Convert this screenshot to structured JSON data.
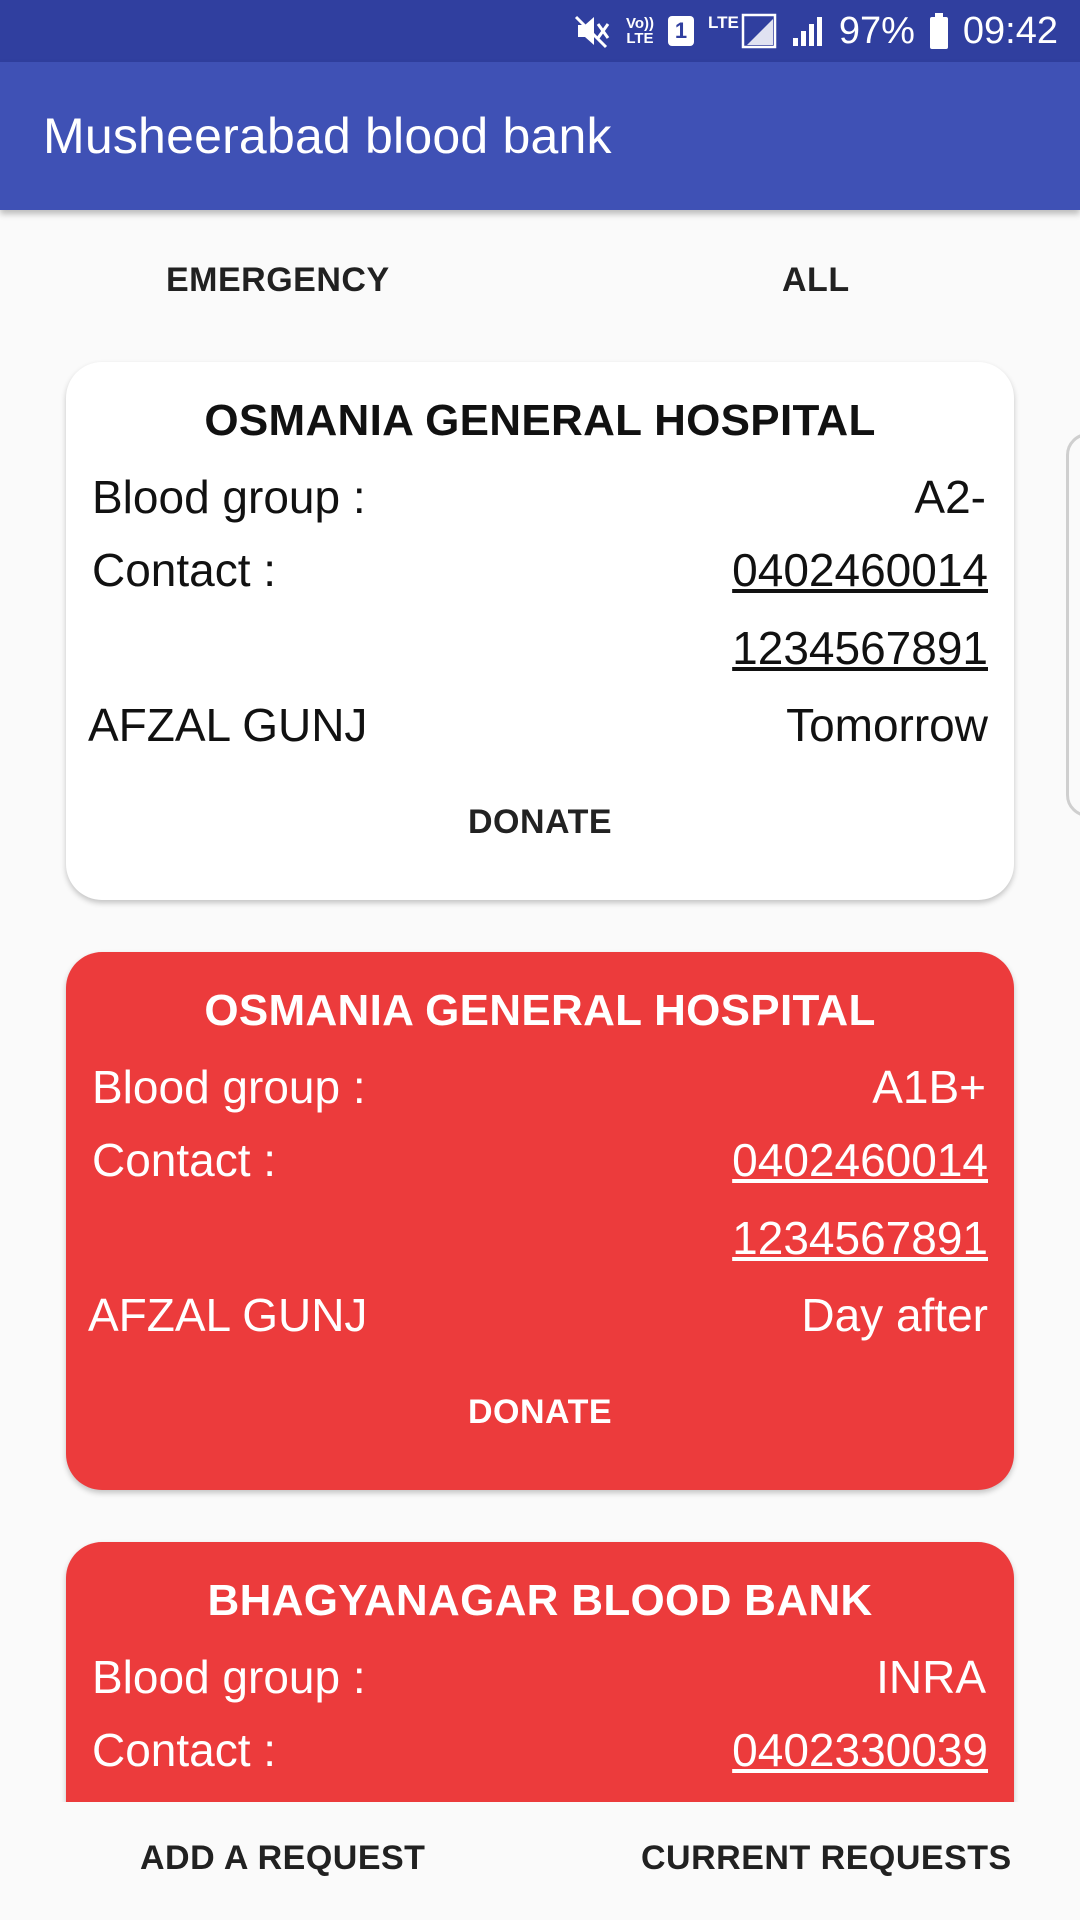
{
  "status_bar": {
    "battery": "97%",
    "time": "09:42",
    "sim_badge": "1",
    "network": "LTE",
    "volte_line1": "Vo))",
    "volte_line2": "LTE"
  },
  "app_bar": {
    "title": "Musheerabad blood bank"
  },
  "tabs": {
    "emergency": "EMERGENCY",
    "all": "ALL"
  },
  "cards": [
    {
      "style": "white",
      "hospital": "OSMANIA GENERAL HOSPITAL",
      "blood_group_label": "Blood group :",
      "blood_group": "A2-",
      "contact_label": "Contact :",
      "phone1": "0402460014",
      "phone2": "1234567891",
      "location": "AFZAL GUNJ",
      "when": "Tomorrow",
      "donate_label": "DONATE"
    },
    {
      "style": "red",
      "hospital": "OSMANIA GENERAL HOSPITAL",
      "blood_group_label": "Blood group :",
      "blood_group": "A1B+",
      "contact_label": "Contact :",
      "phone1": "0402460014",
      "phone2": "1234567891",
      "location": "AFZAL GUNJ",
      "when": "Day after",
      "donate_label": "DONATE"
    },
    {
      "style": "red",
      "hospital": "BHAGYANAGAR BLOOD BANK",
      "blood_group_label": "Blood group :",
      "blood_group": "INRA",
      "contact_label": "Contact :",
      "phone1": "0402330039"
    }
  ],
  "bottom_nav": {
    "add_request": "ADD A REQUEST",
    "current_requests": "CURRENT REQUESTS"
  },
  "colors": {
    "status_bar": "#303f9f",
    "app_bar": "#3f51b5",
    "card_red": "#ec3b3c",
    "card_white": "#ffffff",
    "background": "#fafafa"
  }
}
